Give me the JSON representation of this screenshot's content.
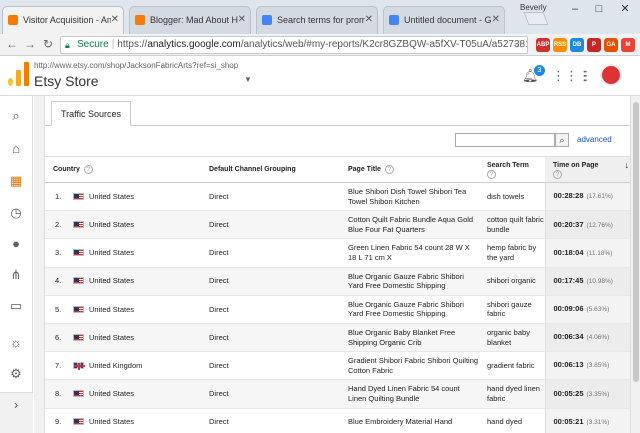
{
  "browser": {
    "tabs": [
      {
        "title": "Visitor Acquisition - Anal",
        "active": true,
        "favicon_color": "#f57c00"
      },
      {
        "title": "Blogger: Mad About Han",
        "active": false,
        "favicon_color": "#f57c00"
      },
      {
        "title": "Search terms for promot",
        "active": false,
        "favicon_color": "#4285f4"
      },
      {
        "title": "Untitled document - Goo",
        "active": false,
        "favicon_color": "#4285f4"
      }
    ],
    "user_badge": "Beverly",
    "secure_label": "Secure",
    "url_prefix": "https://",
    "url_host": "analytics.google.com",
    "url_path": "/analytics/web/#my-reports/K2cr8GZBQW-a5fXV-T05uA/a5273815w50...",
    "extensions": [
      {
        "label": "ABP",
        "color": "#d32f2f"
      },
      {
        "label": "RSS",
        "color": "#fb8c00"
      },
      {
        "label": "DB",
        "color": "#1e88e5"
      },
      {
        "label": "P",
        "color": "#c62828"
      },
      {
        "label": "GA",
        "color": "#e65100"
      },
      {
        "label": "M",
        "color": "#ea4335"
      }
    ]
  },
  "ga": {
    "account_url": "http://www.etsy.com/shop/JacksonFabricArts?ref=si_shop",
    "account_name": "Etsy Store",
    "notifications": "3",
    "icons": {
      "bell": "bell-icon",
      "apps": "apps-grid-icon",
      "menu": "more-vert-icon"
    }
  },
  "nav": {
    "items": [
      "search-icon",
      "home-icon",
      "customization-icon",
      "realtime-clock-icon",
      "audience-person-icon",
      "acquisition-icon",
      "behavior-icon",
      "discover-bulb-icon",
      "admin-gear-icon"
    ],
    "expand": "expand-chevron-icon"
  },
  "report": {
    "tab_label": "Traffic Sources",
    "advanced_label": "advanced",
    "columns": [
      "Country",
      "Default Channel Grouping",
      "Page Title",
      "Search Term",
      "Time on Page"
    ],
    "rows": [
      {
        "index": "1.",
        "flag": "us",
        "country": "United States",
        "channel": "Direct",
        "page_title": "Blue Shibori Dish Towel Shibori Tea Towel Shibori Kitchen",
        "search_term": "dish towels",
        "time": "00:28:28",
        "pct": "(17.61%)"
      },
      {
        "index": "2.",
        "flag": "us",
        "country": "United States",
        "channel": "Direct",
        "page_title": "Cotton Quilt Fabric Bundle Aqua Gold Blue Four Fat Quarters",
        "search_term": "cotton quilt fabric bundle",
        "time": "00:20:37",
        "pct": "(12.76%)"
      },
      {
        "index": "3.",
        "flag": "us",
        "country": "United States",
        "channel": "Direct",
        "page_title": "Green Linen Fabric 54 count 28 W X 18 L 71 cm X",
        "search_term": "hemp fabric by the yard",
        "time": "00:18:04",
        "pct": "(11.18%)"
      },
      {
        "index": "4.",
        "flag": "us",
        "country": "United States",
        "channel": "Direct",
        "page_title": "Blue Organic Gauze Fabric Shibori Yard Free Domestic Shipping",
        "search_term": "shibori organic",
        "time": "00:17:45",
        "pct": "(10.98%)"
      },
      {
        "index": "5.",
        "flag": "us",
        "country": "United States",
        "channel": "Direct",
        "page_title": "Blue Organic Gauze Fabric Shibori Yard Free Domestic Shipping",
        "search_term": "shibori gauze fabric",
        "time": "00:09:06",
        "pct": "(5.63%)"
      },
      {
        "index": "6.",
        "flag": "us",
        "country": "United States",
        "channel": "Direct",
        "page_title": "Blue Organic Baby Blanket Free Shipping Organic Crib",
        "search_term": "organic baby blanket",
        "time": "00:06:34",
        "pct": "(4.06%)"
      },
      {
        "index": "7.",
        "flag": "uk",
        "country": "United Kingdom",
        "channel": "Direct",
        "page_title": "Gradient Shibori Fabric Shibori Quilting Cotton Fabric",
        "search_term": "gradient fabric",
        "time": "00:06:13",
        "pct": "(3.85%)"
      },
      {
        "index": "8.",
        "flag": "us",
        "country": "United States",
        "channel": "Direct",
        "page_title": "Hand Dyed Linen Fabric 54 count Linen Quilting Bundle",
        "search_term": "hand dyed linen fabric",
        "time": "00:05:25",
        "pct": "(3.35%)"
      },
      {
        "index": "9.",
        "flag": "us",
        "country": "United States",
        "channel": "Direct",
        "page_title": "Blue Embroidery Material Hand",
        "search_term": "hand dyed",
        "time": "00:05:21",
        "pct": "(3.31%)"
      }
    ]
  }
}
